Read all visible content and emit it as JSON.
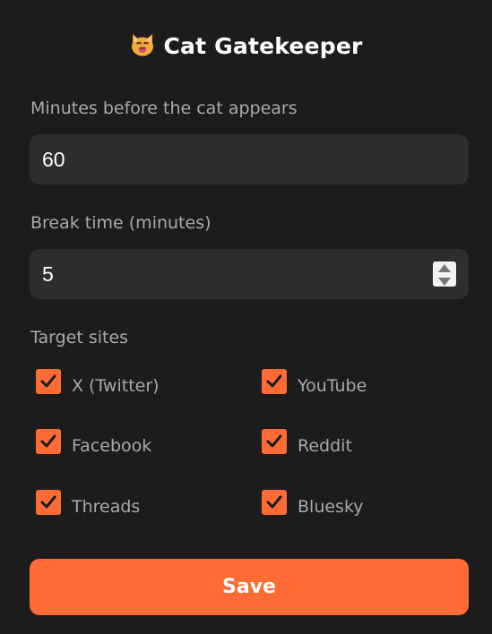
{
  "app": {
    "title": "Cat Gatekeeper",
    "title_icon": "cat-face-icon"
  },
  "form": {
    "minutes_label": "Minutes before the cat appears",
    "minutes_value": "60",
    "break_label": "Break time (minutes)",
    "break_value": "5",
    "sites_label": "Target sites"
  },
  "sites": [
    {
      "label": "X (Twitter)",
      "checked": true
    },
    {
      "label": "YouTube",
      "checked": true
    },
    {
      "label": "Facebook",
      "checked": true
    },
    {
      "label": "Reddit",
      "checked": true
    },
    {
      "label": "Threads",
      "checked": true
    },
    {
      "label": "Bluesky",
      "checked": true
    }
  ],
  "actions": {
    "save_label": "Save"
  },
  "colors": {
    "background": "#1c1c1c",
    "field": "#2e2e2e",
    "accent": "#ff6b35",
    "label": "#a9a9a9",
    "text": "#ffffff"
  }
}
